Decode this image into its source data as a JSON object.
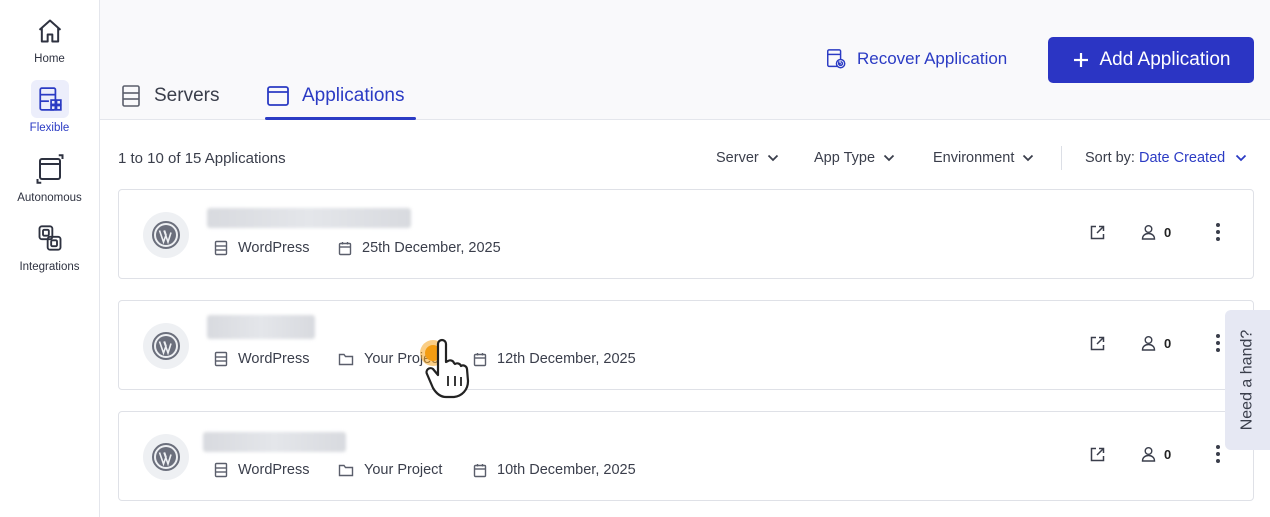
{
  "sidebar": {
    "items": [
      {
        "label": "Home",
        "icon": "home-icon"
      },
      {
        "label": "Flexible",
        "icon": "flexible-icon",
        "active": true
      },
      {
        "label": "Autonomous",
        "icon": "autonomous-icon"
      },
      {
        "label": "Integrations",
        "icon": "integrations-icon"
      }
    ]
  },
  "header": {
    "recover_label": "Recover Application",
    "add_label": "Add Application",
    "tabs": [
      {
        "label": "Servers",
        "icon": "server-icon"
      },
      {
        "label": "Applications",
        "icon": "window-icon",
        "active": true
      }
    ]
  },
  "toolbar": {
    "count_text": "1 to 10 of 15 Applications",
    "filters": [
      "Server",
      "App Type",
      "Environment"
    ],
    "sort_label": "Sort by:",
    "sort_value": "Date Created"
  },
  "apps": [
    {
      "type": "WordPress",
      "project": "",
      "date": "25th December, 2025",
      "users": "0"
    },
    {
      "type": "WordPress",
      "project": "Your Project",
      "date": "12th December, 2025",
      "users": "0"
    },
    {
      "type": "WordPress",
      "project": "Your Project",
      "date": "10th December, 2025",
      "users": "0"
    }
  ],
  "help_label": "Need a hand?",
  "colors": {
    "accent": "#2b35c4",
    "border": "#dfe1e7",
    "background": "#f9f9fb"
  }
}
